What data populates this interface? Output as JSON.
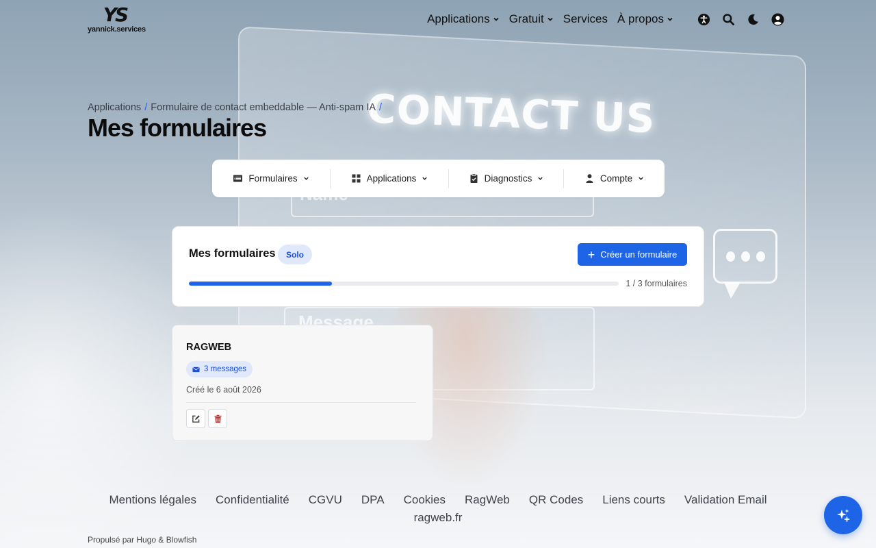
{
  "header": {
    "logo_mark": "YS",
    "logo_text": "yannick.services",
    "nav": [
      {
        "label": "Applications",
        "has_dropdown": true
      },
      {
        "label": "Gratuit",
        "has_dropdown": true
      },
      {
        "label": "Services",
        "has_dropdown": false
      },
      {
        "label": "À propos",
        "has_dropdown": true
      }
    ],
    "icons": [
      "accessibility-icon",
      "search-icon",
      "moon-icon",
      "user-icon"
    ]
  },
  "background": {
    "contact_text": "CONTACT US",
    "field1_text": "Name",
    "field2_text": "Message"
  },
  "breadcrumb": {
    "items": [
      "Applications",
      "Formulaire de contact embeddable — Anti-spam IA"
    ],
    "separator": "/"
  },
  "page_title": "Mes formulaires",
  "subnav": [
    {
      "label": "Formulaires",
      "icon": "list-icon"
    },
    {
      "label": "Applications",
      "icon": "grid-icon"
    },
    {
      "label": "Diagnostics",
      "icon": "clipboard-icon"
    },
    {
      "label": "Compte",
      "icon": "person-icon"
    }
  ],
  "summary": {
    "title": "Mes formulaires",
    "plan_badge": "Solo",
    "create_button": "Créer un formulaire",
    "usage_current": 1,
    "usage_max": 3,
    "usage_label": "1 / 3 formulaires"
  },
  "forms": [
    {
      "name": "RAGWEB",
      "messages_label": "3 messages",
      "created_label": "Créé le 6 août 2026"
    }
  ],
  "footer": {
    "links": [
      "Mentions légales",
      "Confidentialité",
      "CGVU",
      "DPA",
      "Cookies",
      "RagWeb",
      "QR Codes",
      "Liens courts",
      "Validation Email",
      "ragweb.fr"
    ],
    "powered_by": "Propulsé par Hugo & Blowfish"
  },
  "colors": {
    "accent": "#1d64e6",
    "badge_bg": "#dfe9fb",
    "danger": "#dc2626"
  }
}
